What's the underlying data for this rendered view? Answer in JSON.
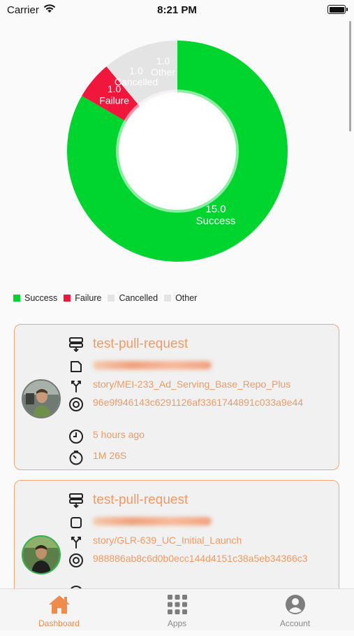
{
  "status_bar": {
    "carrier": "Carrier",
    "time": "8:21 PM"
  },
  "chart_data": {
    "type": "pie",
    "variant": "donut",
    "slices": [
      {
        "label": "Success",
        "value": 15.0,
        "value_label": "15.0",
        "color": "#00d42f"
      },
      {
        "label": "Failure",
        "value": 1.0,
        "value_label": "1.0",
        "color": "#f0163c"
      },
      {
        "label": "Cancelled",
        "value": 1.0,
        "value_label": "1.0",
        "color": "#e4e4e4"
      },
      {
        "label": "Other",
        "value": 1.0,
        "value_label": "1.0",
        "color": "#e4e4e4"
      }
    ],
    "legend": [
      "Success",
      "Failure",
      "Cancelled",
      "Other"
    ],
    "legend_position": "bottom-left"
  },
  "legend": {
    "items": [
      {
        "label": "Success",
        "color": "#00d42f"
      },
      {
        "label": "Failure",
        "color": "#f0163c"
      },
      {
        "label": "Cancelled",
        "color": "#e4e4e4"
      },
      {
        "label": "Other",
        "color": "#e4e4e4"
      }
    ]
  },
  "builds": [
    {
      "workflow": "test-pull-request",
      "branch": "story/MEI-233_Ad_Serving_Base_Repo_Plus",
      "commit": "96e9f946143c6291126af3361744891c033a9e44",
      "triggered": "5 hours ago",
      "duration": "1M 26S"
    },
    {
      "workflow": "test-pull-request",
      "branch": "story/GLR-639_UC_Initial_Launch",
      "commit": "988886ab8c6d0b0ecc144d4151c38a5eb34366c3"
    }
  ],
  "tabbar": {
    "tabs": [
      {
        "label": "Dashboard",
        "icon": "home-icon"
      },
      {
        "label": "Apps",
        "icon": "grid-icon"
      },
      {
        "label": "Account",
        "icon": "user-icon"
      }
    ],
    "active": "Dashboard",
    "accent": "#ee8b4d"
  }
}
